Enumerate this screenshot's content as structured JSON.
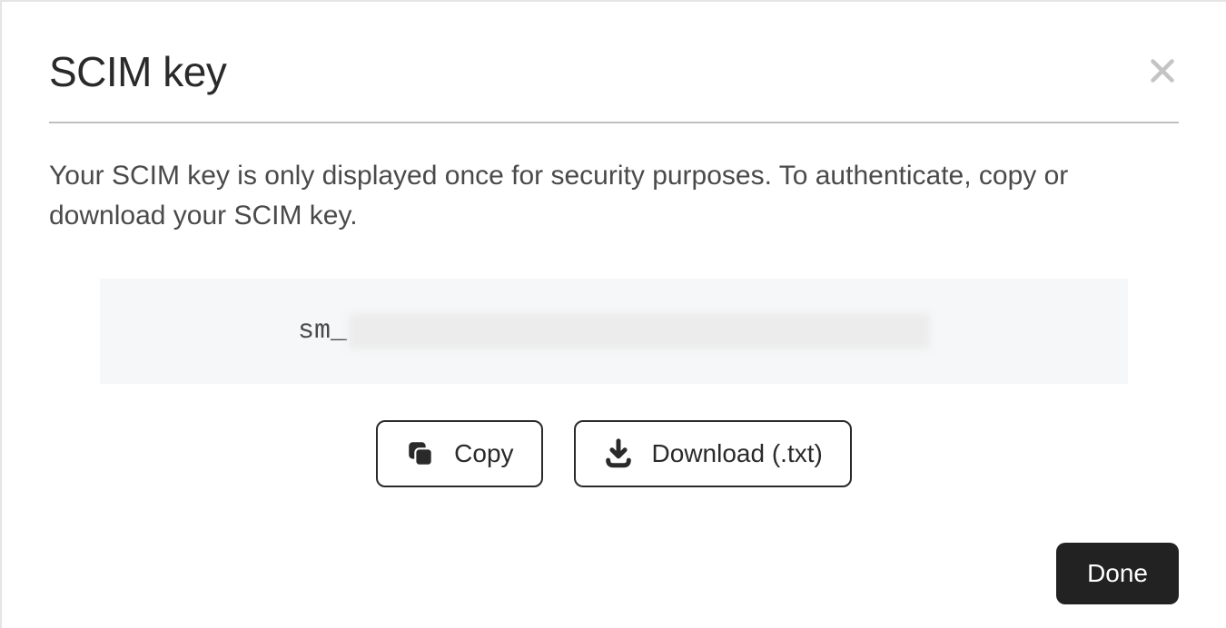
{
  "modal": {
    "title": "SCIM key",
    "description": "Your SCIM key is only displayed once for security purposes. To authenticate, copy or download your SCIM key.",
    "key_prefix": "sm_",
    "copy_label": "Copy",
    "download_label": "Download (.txt)",
    "done_label": "Done"
  }
}
